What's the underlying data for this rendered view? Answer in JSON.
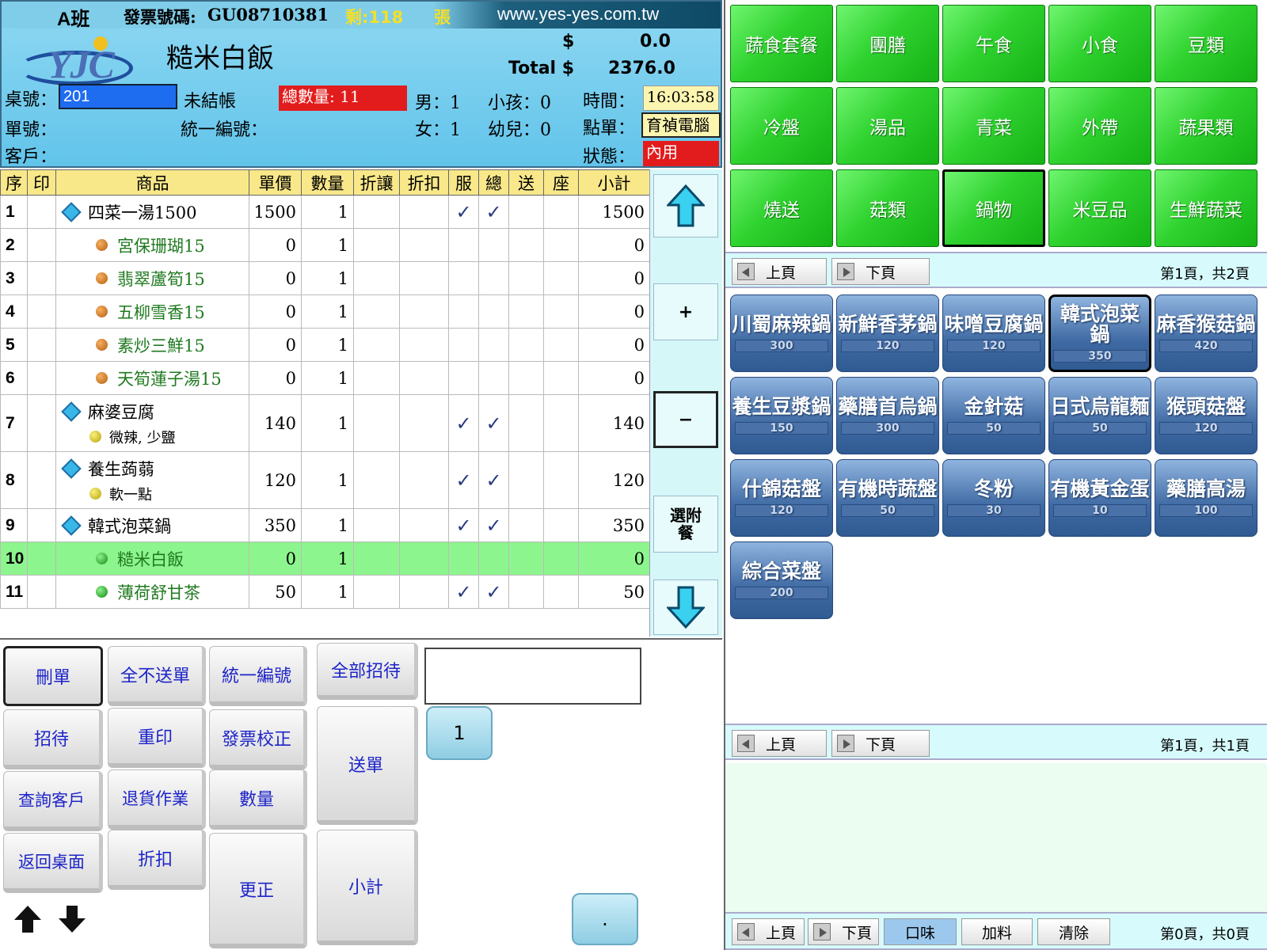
{
  "header": {
    "shift": "A班",
    "invoice_label": "發票號碼:",
    "invoice_no": "GU08710381",
    "remain_label": "剩:118",
    "remain_unit": "張",
    "website": "www.yes-yes.com.tw",
    "logo": "YJC",
    "current_item": "糙米白飯",
    "price_symbol": "$",
    "price_value": "0.0",
    "total_label": "Total $",
    "total_value": "2376.0",
    "table_label": "桌號：",
    "table_no": "201",
    "checkout_status": "未結帳",
    "total_qty": "總數量: 11",
    "male": "男：1",
    "child": "小孩：0",
    "time_label": "時間：",
    "time_value": "16:03:58",
    "order_label": "單號：",
    "tax_label": "統一編號：",
    "female": "女：1",
    "infant": "幼兒：0",
    "staff_label": "點單：",
    "staff_value": "育禎電腦",
    "customer_label": "客戶：",
    "status_label": "狀態：",
    "status_value": "內用"
  },
  "columns": [
    "序",
    "印",
    "商品",
    "單價",
    "數量",
    "折讓",
    "折扣",
    "服",
    "總",
    "送",
    "座",
    "小計"
  ],
  "rows": [
    {
      "seq": "1",
      "type": "main",
      "name": "四菜一湯1500",
      "price": "1500",
      "qty": "1",
      "fu": "✓",
      "zong": "✓",
      "subtotal": "1500"
    },
    {
      "seq": "2",
      "type": "sub",
      "name": "宮保珊瑚15",
      "price": "0",
      "qty": "1",
      "fu": "",
      "zong": "",
      "subtotal": "0"
    },
    {
      "seq": "3",
      "type": "sub",
      "name": "翡翠蘆筍15",
      "price": "0",
      "qty": "1",
      "fu": "",
      "zong": "",
      "subtotal": "0"
    },
    {
      "seq": "4",
      "type": "sub",
      "name": "五柳雪香15",
      "price": "0",
      "qty": "1",
      "fu": "",
      "zong": "",
      "subtotal": "0"
    },
    {
      "seq": "5",
      "type": "sub",
      "name": "素炒三鮮15",
      "price": "0",
      "qty": "1",
      "fu": "",
      "zong": "",
      "subtotal": "0"
    },
    {
      "seq": "6",
      "type": "sub",
      "name": "天筍蓮子湯15",
      "price": "0",
      "qty": "1",
      "fu": "",
      "zong": "",
      "subtotal": "0"
    },
    {
      "seq": "7",
      "type": "main",
      "name": "麻婆豆腐",
      "note": "微辣, 少鹽",
      "price": "140",
      "qty": "1",
      "fu": "✓",
      "zong": "✓",
      "subtotal": "140"
    },
    {
      "seq": "8",
      "type": "main",
      "name": "養生蒟蒻",
      "note": "軟一點",
      "price": "120",
      "qty": "1",
      "fu": "✓",
      "zong": "✓",
      "subtotal": "120"
    },
    {
      "seq": "9",
      "type": "main",
      "name": "韓式泡菜鍋",
      "price": "350",
      "qty": "1",
      "fu": "✓",
      "zong": "✓",
      "subtotal": "350"
    },
    {
      "seq": "10",
      "type": "subg",
      "name": "糙米白飯",
      "price": "0",
      "qty": "1",
      "fu": "",
      "zong": "",
      "subtotal": "0",
      "selected": true
    },
    {
      "seq": "11",
      "type": "subg",
      "name": "薄荷舒甘茶",
      "price": "50",
      "qty": "1",
      "fu": "✓",
      "zong": "✓",
      "subtotal": "50"
    }
  ],
  "side": {
    "plus": "+",
    "minus": "−",
    "combo": "選附餐"
  },
  "keys": {
    "delete": "刪單",
    "no_send": "全不送單",
    "tax_id": "統一編號",
    "treat_all": "全部招待",
    "treat": "招待",
    "reprint": "重印",
    "invoice_fix": "發票校正",
    "send": "送單",
    "query_customer": "查詢客戶",
    "returns": "退貨作業",
    "qty": "數量",
    "back_desk": "返回桌面",
    "discount": "折扣",
    "correct": "更正",
    "subtotal": "小計",
    "num1": "1",
    "dot": "."
  },
  "categories": [
    "蔬食套餐",
    "團膳",
    "午食",
    "小食",
    "豆類",
    "冷盤",
    "湯品",
    "青菜",
    "外帶",
    "蔬果類",
    "燒送",
    "菇類",
    "鍋物",
    "米豆品",
    "生鮮蔬菜"
  ],
  "pager1": {
    "prev": "上頁",
    "next": "下頁",
    "info": "第1頁，共2頁"
  },
  "dishes": [
    {
      "name": "川蜀麻辣鍋",
      "price": "300"
    },
    {
      "name": "新鮮香茅鍋",
      "price": "120"
    },
    {
      "name": "味噌豆腐鍋",
      "price": "120"
    },
    {
      "name": "韓式泡菜鍋",
      "price": "350",
      "selected": true
    },
    {
      "name": "麻香猴菇鍋",
      "price": "420"
    },
    {
      "name": "養生豆漿鍋",
      "price": "150"
    },
    {
      "name": "藥膳首烏鍋",
      "price": "300"
    },
    {
      "name": "金針菇",
      "price": "50"
    },
    {
      "name": "日式烏龍麵",
      "price": "50"
    },
    {
      "name": "猴頭菇盤",
      "price": "120"
    },
    {
      "name": "什錦菇盤",
      "price": "120"
    },
    {
      "name": "有機時蔬盤",
      "price": "50"
    },
    {
      "name": "冬粉",
      "price": "30"
    },
    {
      "name": "有機黃金蛋",
      "price": "10"
    },
    {
      "name": "藥膳高湯",
      "price": "100"
    },
    {
      "name": "綜合菜盤",
      "price": "200"
    }
  ],
  "pager2": {
    "prev": "上頁",
    "next": "下頁",
    "info": "第1頁，共1頁"
  },
  "pager3": {
    "prev": "上頁",
    "next": "下頁",
    "taste": "口味",
    "extra": "加料",
    "clear": "清除",
    "info": "第0頁，共0頁"
  },
  "colors": {
    "header": "#62c4ea",
    "category": "#2fd22f",
    "dish": "#3f6aa3",
    "selected_row": "#8df58d",
    "alert": "#e21c1c",
    "time_bg": "#fbf5b0"
  }
}
